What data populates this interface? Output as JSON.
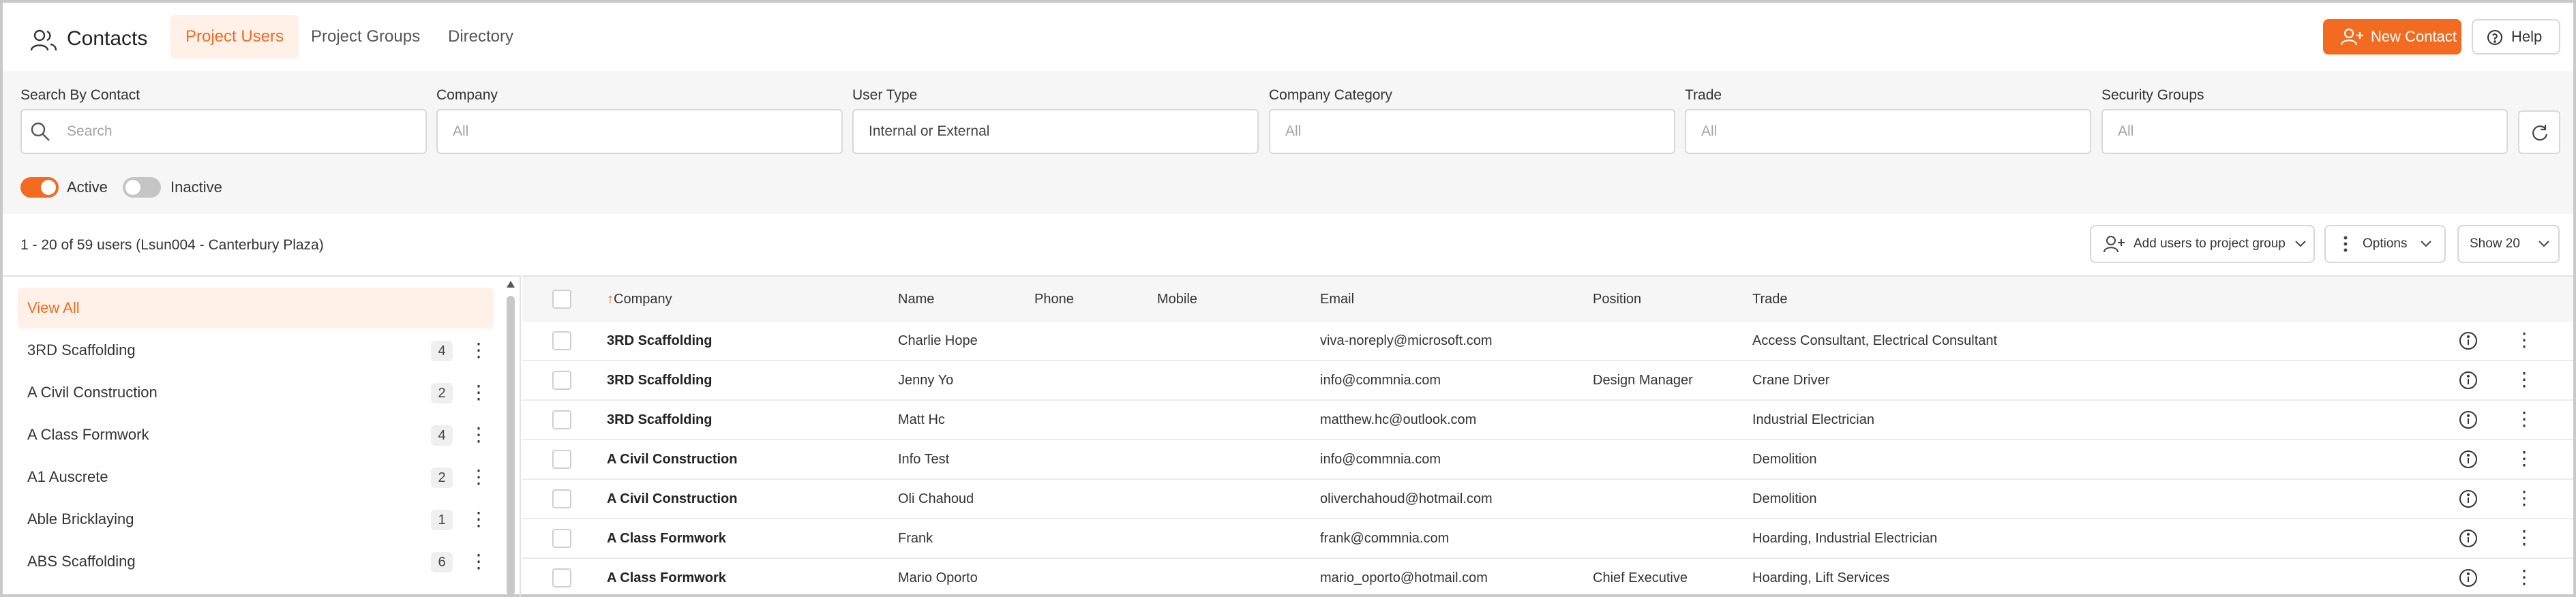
{
  "header": {
    "title": "Contacts",
    "tabs": [
      {
        "label": "Project Users",
        "active": true
      },
      {
        "label": "Project Groups",
        "active": false
      },
      {
        "label": "Directory",
        "active": false
      }
    ],
    "new_contact_label": "New Contact",
    "help_label": "Help"
  },
  "filters": {
    "search": {
      "label": "Search By Contact",
      "placeholder": "Search"
    },
    "company": {
      "label": "Company",
      "value": "All"
    },
    "user_type": {
      "label": "User Type",
      "value": "Internal or External"
    },
    "company_category": {
      "label": "Company Category",
      "value": "All"
    },
    "trade": {
      "label": "Trade",
      "value": "All"
    },
    "security_groups": {
      "label": "Security Groups",
      "value": "All"
    },
    "active_label": "Active",
    "inactive_label": "Inactive",
    "active_on": true,
    "inactive_on": false
  },
  "summary": {
    "text": "1 - 20 of 59 users (Lsun004 - Canterbury Plaza)",
    "add_to_group_label": "Add users to project group",
    "options_label": "Options",
    "show_label": "Show 20"
  },
  "left_list": {
    "items": [
      {
        "label": "View All",
        "count": "",
        "active": true
      },
      {
        "label": "3RD Scaffolding",
        "count": "4"
      },
      {
        "label": "A Civil Construction",
        "count": "2"
      },
      {
        "label": "A Class Formwork",
        "count": "4"
      },
      {
        "label": "A1 Auscrete",
        "count": "2"
      },
      {
        "label": "Able Bricklaying",
        "count": "1"
      },
      {
        "label": "ABS Scaffolding",
        "count": "6"
      }
    ]
  },
  "table": {
    "sort_indicator": "↑",
    "columns": [
      "Company",
      "Name",
      "Phone",
      "Mobile",
      "Email",
      "Position",
      "Trade"
    ],
    "rows": [
      {
        "company": "3RD Scaffolding",
        "name": "Charlie Hope",
        "phone": "",
        "mobile": "",
        "email": "viva-noreply@microsoft.com",
        "position": "",
        "trade": "Access Consultant, Electrical Consultant"
      },
      {
        "company": "3RD Scaffolding",
        "name": "Jenny Yo",
        "phone": "",
        "mobile": "",
        "email": "info@commnia.com",
        "position": "Design Manager",
        "trade": "Crane Driver"
      },
      {
        "company": "3RD Scaffolding",
        "name": "Matt Hc",
        "phone": "",
        "mobile": "",
        "email": "matthew.hc@outlook.com",
        "position": "",
        "trade": "Industrial Electrician"
      },
      {
        "company": "A Civil Construction",
        "name": "Info Test",
        "phone": "",
        "mobile": "",
        "email": "info@commnia.com",
        "position": "",
        "trade": "Demolition"
      },
      {
        "company": "A Civil Construction",
        "name": "Oli Chahoud",
        "phone": "",
        "mobile": "",
        "email": "oliverchahoud@hotmail.com",
        "position": "",
        "trade": "Demolition"
      },
      {
        "company": "A Class Formwork",
        "name": "Frank",
        "phone": "",
        "mobile": "",
        "email": "frank@commnia.com",
        "position": "",
        "trade": "Hoarding, Industrial Electrician"
      },
      {
        "company": "A Class Formwork",
        "name": "Mario Oporto",
        "phone": "",
        "mobile": "",
        "email": "mario_oporto@hotmail.com",
        "position": "Chief Executive",
        "trade": "Hoarding, Lift Services"
      }
    ]
  },
  "colors": {
    "accent": "#f26b21",
    "accent_light": "#fff1e8",
    "panel_bg": "#f6f6f7"
  }
}
